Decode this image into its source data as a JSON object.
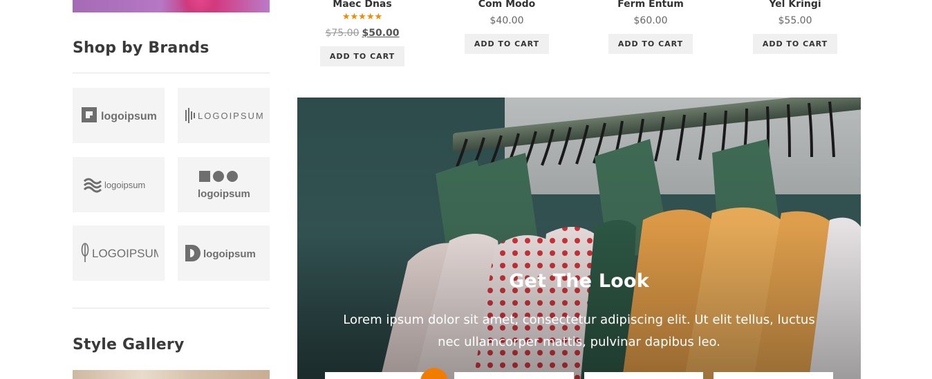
{
  "sidebar": {
    "brands_title": "Shop by Brands",
    "brands": [
      {
        "icon": "logo-q-icon",
        "label": "logoipsum"
      },
      {
        "icon": "logo-bars-icon",
        "label": "LOGOIPSUM"
      },
      {
        "icon": "logo-waves-icon",
        "label": "logoipsum"
      },
      {
        "icon": "logo-shapes-icon",
        "label": "logoipsum"
      },
      {
        "icon": "logo-leaf-icon",
        "label": "LOGOIPSUM"
      },
      {
        "icon": "logo-d-icon",
        "label": "logoipsum"
      }
    ],
    "gallery_title": "Style Gallery"
  },
  "products": [
    {
      "name": "Maec Dnas",
      "rating_stars": "★★★★★",
      "old_price": "$75.00",
      "price": "$50.00",
      "button": "ADD TO CART"
    },
    {
      "name": "Com Modo",
      "price": "$40.00",
      "button": "ADD TO CART"
    },
    {
      "name": "Ferm Entum",
      "price": "$60.00",
      "button": "ADD TO CART"
    },
    {
      "name": "Yel Kringi",
      "price": "$55.00",
      "button": "ADD TO CART"
    }
  ],
  "hero": {
    "title": "Get The Look",
    "text": "Lorem ipsum dolor sit amet, consectetur adipiscing elit. Ut elit tellus, luctus nec ullamcorper mattis, pulvinar dapibus leo."
  },
  "colors": {
    "accent": "#f07c00",
    "star": "#f28b00",
    "tile_bg": "#f4f4f4"
  }
}
